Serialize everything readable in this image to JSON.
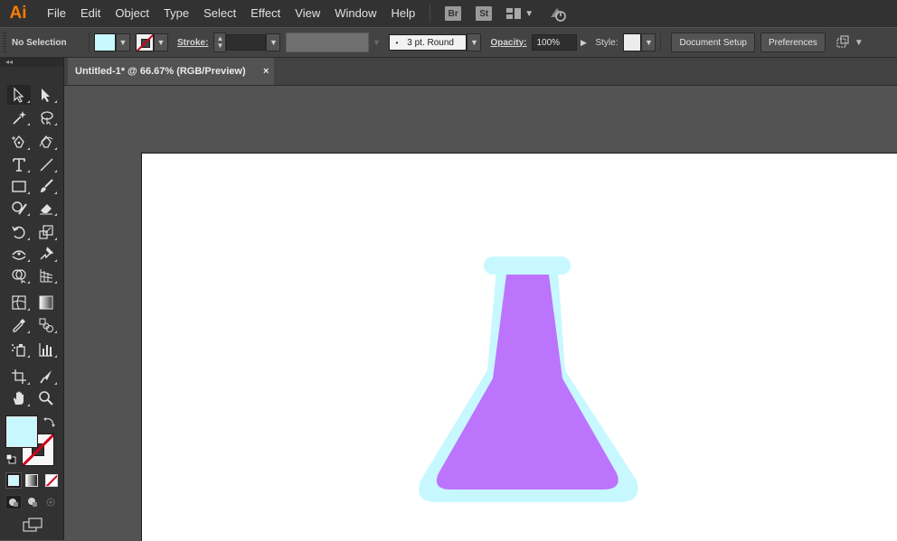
{
  "app": {
    "logo": "Ai",
    "menu": [
      "File",
      "Edit",
      "Object",
      "Type",
      "Select",
      "Effect",
      "View",
      "Window",
      "Help"
    ],
    "bridge_badge": "Br",
    "stock_badge": "St"
  },
  "control_bar": {
    "selection_status": "No Selection",
    "fill_color": "#C8F8FF",
    "stroke_label": "Stroke:",
    "stroke_weight": "",
    "brush_dot": "•",
    "brush_label": "3 pt. Round",
    "opacity_label": "Opacity:",
    "opacity_value": "100%",
    "style_label": "Style:",
    "document_setup": "Document Setup",
    "preferences": "Preferences"
  },
  "tools_panel": {
    "collapse_glyph": "◂◂",
    "tools": [
      "selection-tool",
      "direct-selection-tool",
      "magic-wand-tool",
      "lasso-tool",
      "pen-tool",
      "curvature-tool",
      "type-tool",
      "line-segment-tool",
      "rectangle-tool",
      "paintbrush-tool",
      "shaper-tool",
      "eraser-tool",
      "rotate-tool",
      "scale-tool",
      "width-tool",
      "puppet-warp-tool",
      "shape-builder-tool",
      "perspective-grid-tool",
      "mesh-tool",
      "gradient-tool",
      "eyedropper-tool",
      "blend-tool",
      "symbol-sprayer-tool",
      "column-graph-tool",
      "artboard-tool",
      "slice-tool",
      "hand-tool",
      "zoom-tool"
    ],
    "fill_color": "#C8F8FF",
    "stroke_color": "none"
  },
  "document": {
    "tab_title": "Untitled-1* @ 66.67% (RGB/Preview)",
    "close_glyph": "×"
  },
  "artwork": {
    "flask_outline_color": "#C8F8FF",
    "flask_liquid_color": "#BC74FC"
  }
}
